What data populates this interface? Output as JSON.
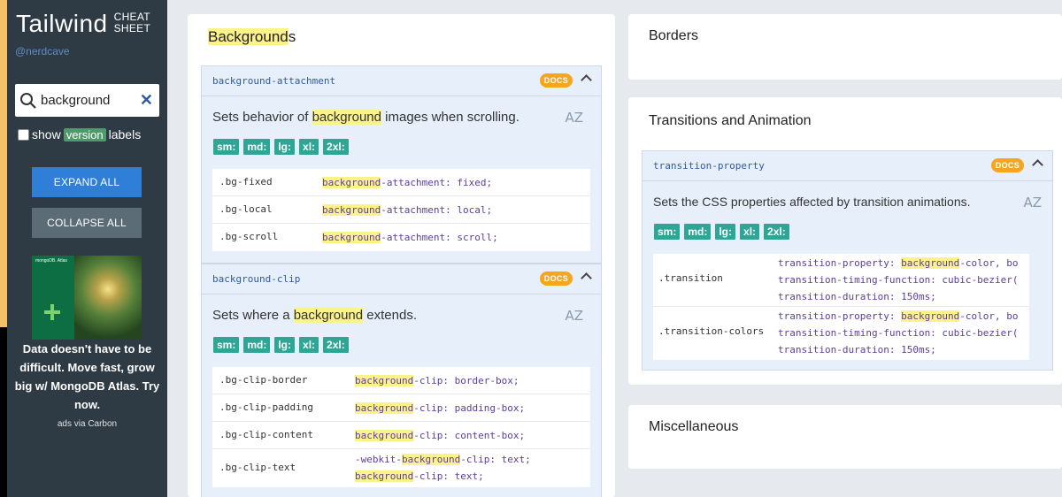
{
  "sidebar": {
    "brand_title": "Tailwind",
    "brand_sub_1": "CHEAT",
    "brand_sub_2": "SHEET",
    "handle": "@nerdcave",
    "search_value": "background",
    "show_label_pre": "show",
    "show_label_pill": "version",
    "show_label_post": "labels",
    "expand_all": "EXPAND ALL",
    "collapse_all": "COLLAPSE ALL",
    "ad_brand": "mongoDB. Atlas",
    "ad_text": "Data doesn't have to be difficult. Move fast, grow big w/ MongoDB Atlas. Try now.",
    "ad_via": "ads via Carbon"
  },
  "backgrounds": {
    "title_hl": "Background",
    "title_rest": "s",
    "attachment": {
      "name": "background-attachment",
      "docs": "DOCS",
      "desc_pre": "Sets behavior of ",
      "desc_hl": "background",
      "desc_post": " images when scrolling.",
      "az": "AZ",
      "breakpoints": [
        "sm:",
        "md:",
        "lg:",
        "xl:",
        "2xl:"
      ],
      "rows": [
        {
          "cls": ".bg-fixed",
          "hl": "background",
          "prop": "-attachment: fixed;"
        },
        {
          "cls": ".bg-local",
          "hl": "background",
          "prop": "-attachment: local;"
        },
        {
          "cls": ".bg-scroll",
          "hl": "background",
          "prop": "-attachment: scroll;"
        }
      ]
    },
    "clip": {
      "name": "background-clip",
      "docs": "DOCS",
      "desc_pre": "Sets where a ",
      "desc_hl": "background",
      "desc_post": " extends.",
      "az": "AZ",
      "breakpoints": [
        "sm:",
        "md:",
        "lg:",
        "xl:",
        "2xl:"
      ],
      "rows": [
        {
          "cls": ".bg-clip-border",
          "lines": [
            {
              "pre": "",
              "hl": "background",
              "post": "-clip: border-box;"
            }
          ]
        },
        {
          "cls": ".bg-clip-padding",
          "lines": [
            {
              "pre": "",
              "hl": "background",
              "post": "-clip: padding-box;"
            }
          ]
        },
        {
          "cls": ".bg-clip-content",
          "lines": [
            {
              "pre": "",
              "hl": "background",
              "post": "-clip: content-box;"
            }
          ]
        },
        {
          "cls": ".bg-clip-text",
          "lines": [
            {
              "pre": "-webkit-",
              "hl": "background",
              "post": "-clip: text;"
            },
            {
              "pre": "",
              "hl": "background",
              "post": "-clip: text;"
            }
          ]
        }
      ]
    }
  },
  "borders": {
    "title": "Borders"
  },
  "transitions": {
    "title": "Transitions and Animation",
    "property": {
      "name": "transition-property",
      "docs": "DOCS",
      "desc": "Sets the CSS properties affected by transition animations.",
      "az": "AZ",
      "breakpoints": [
        "sm:",
        "md:",
        "lg:",
        "xl:",
        "2xl:"
      ],
      "rows": [
        {
          "cls": ".transition",
          "lines": [
            {
              "pre": "transition-property: ",
              "hl": "background",
              "post": "-color, bo"
            },
            {
              "pre": "transition-timing-function: cubic-bezier(",
              "hl": "",
              "post": ""
            },
            {
              "pre": "transition-duration: 150ms;",
              "hl": "",
              "post": ""
            }
          ]
        },
        {
          "cls": ".transition-colors",
          "lines": [
            {
              "pre": "transition-property: ",
              "hl": "background",
              "post": "-color, bo"
            },
            {
              "pre": "transition-timing-function: cubic-bezier(",
              "hl": "",
              "post": ""
            },
            {
              "pre": "transition-duration: 150ms;",
              "hl": "",
              "post": ""
            }
          ]
        }
      ]
    }
  },
  "misc": {
    "title": "Miscellaneous"
  }
}
